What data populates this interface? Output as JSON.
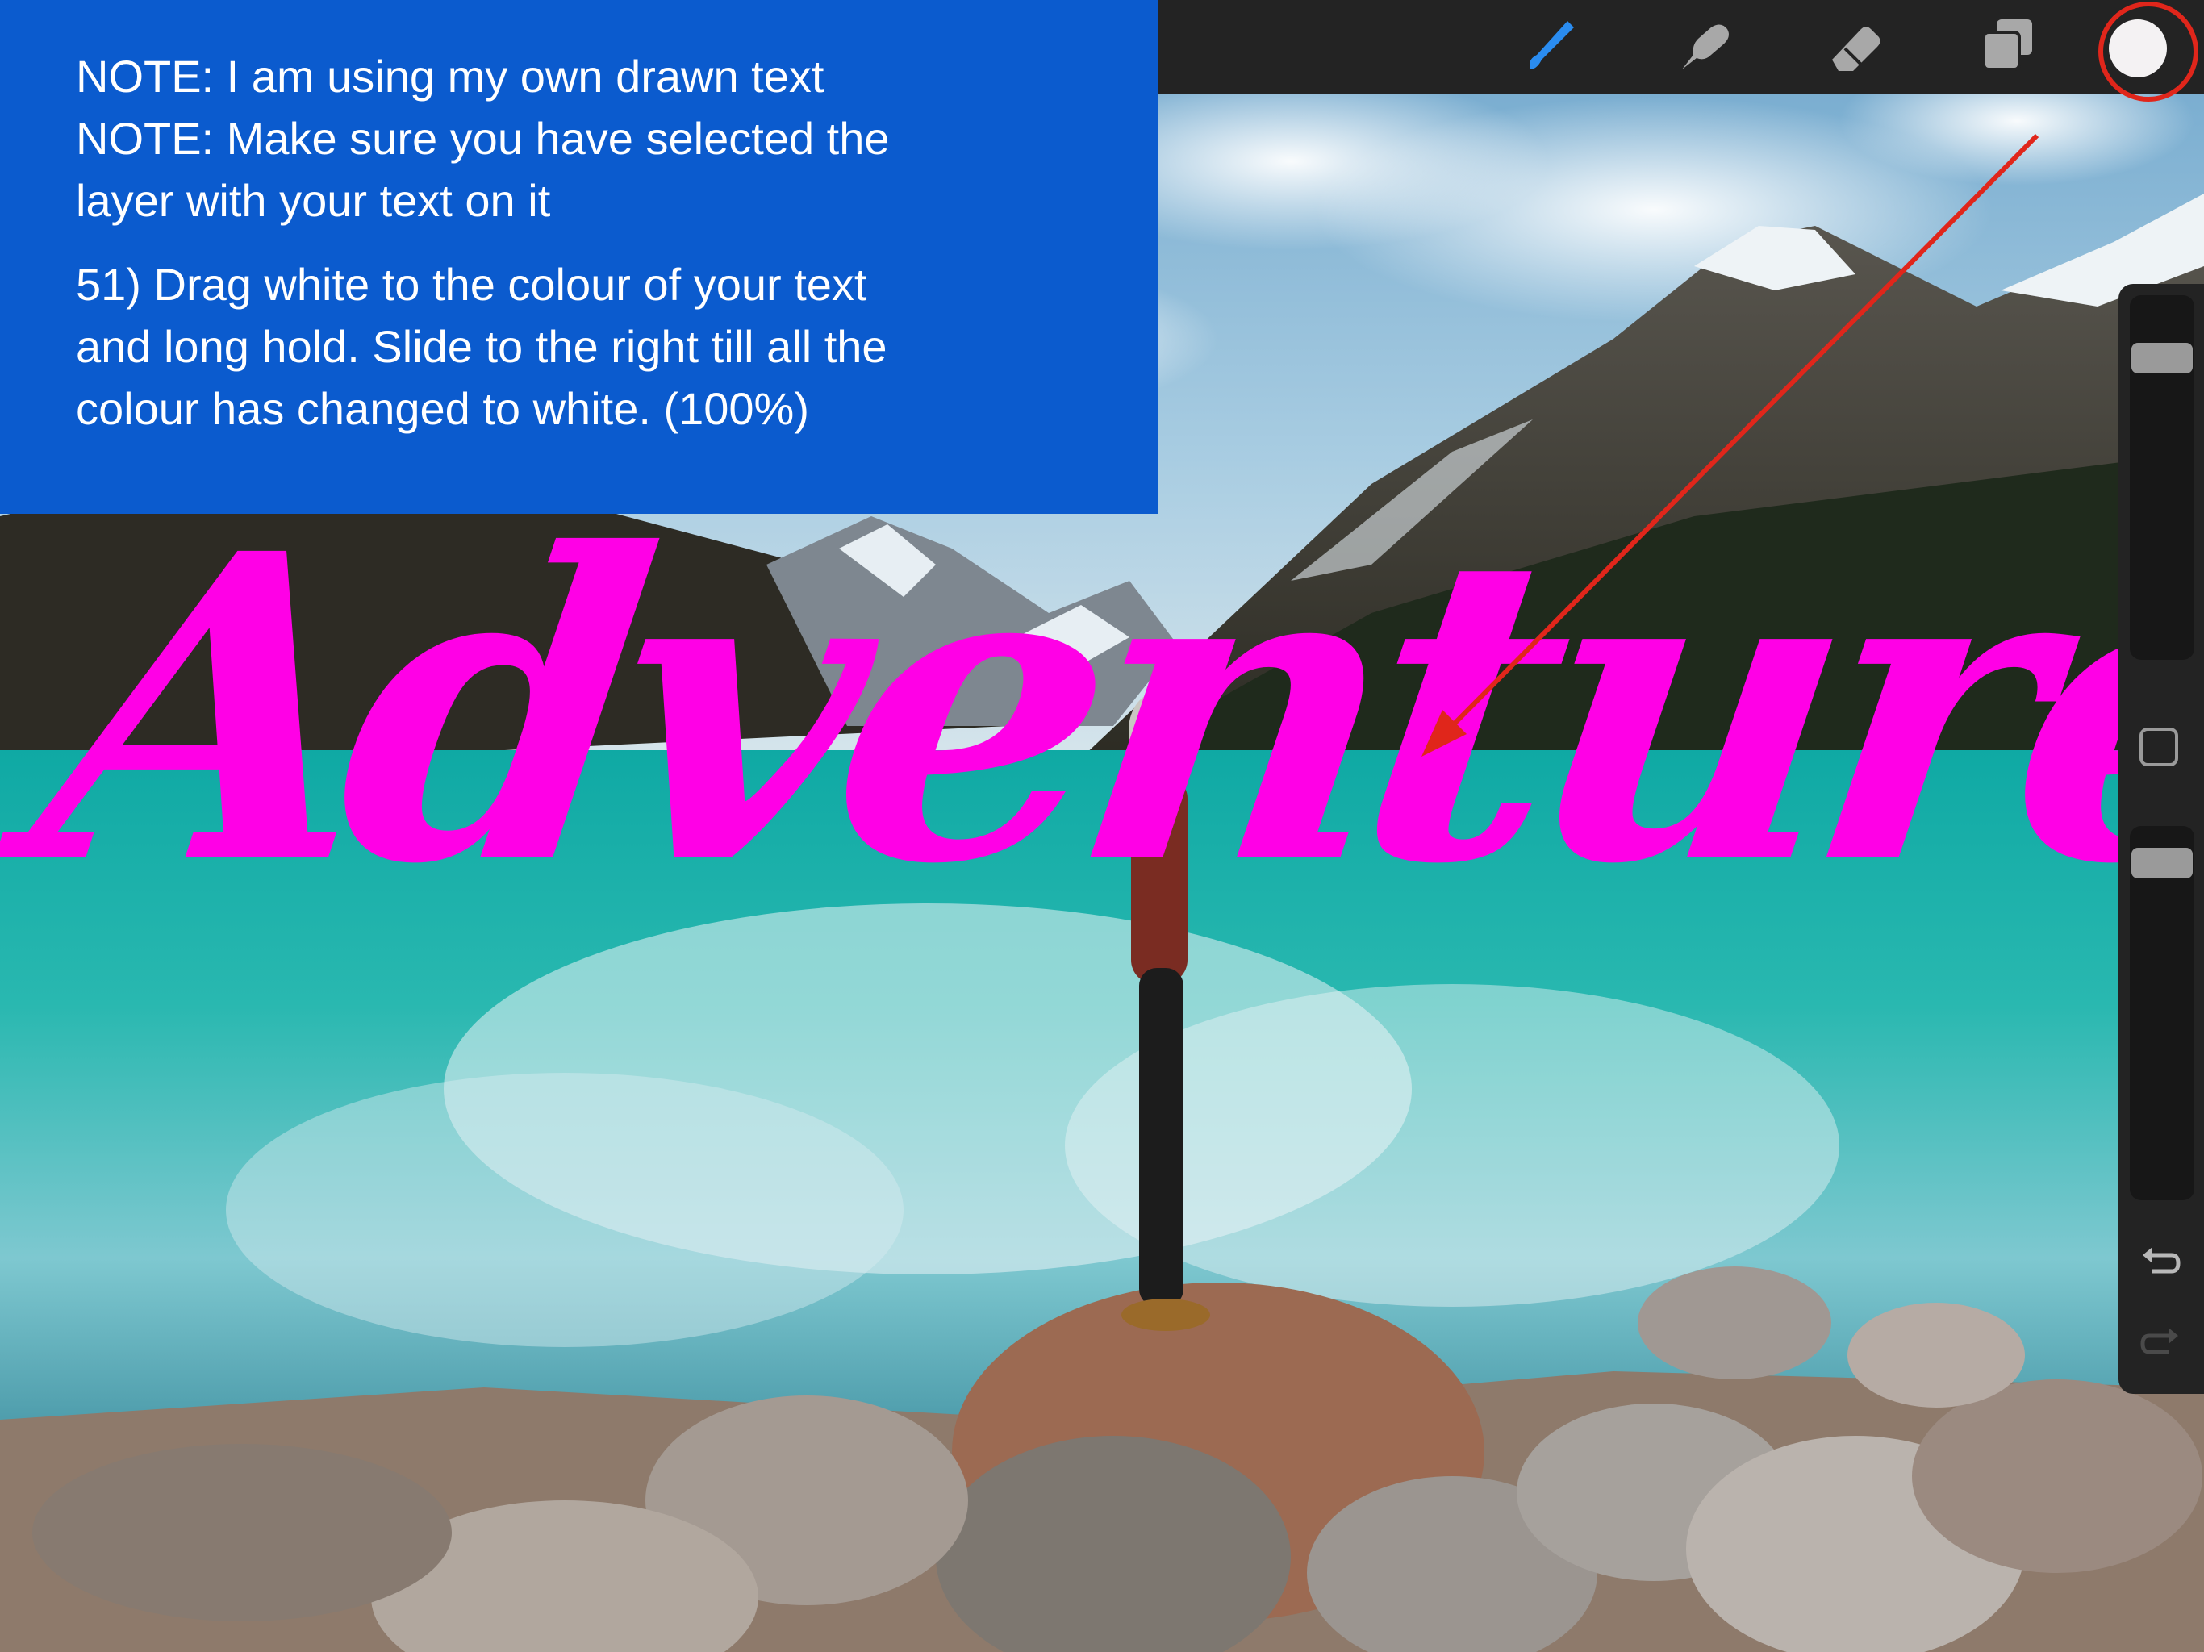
{
  "toolbar": {
    "tools": [
      "brush-icon",
      "smudge-icon",
      "eraser-icon",
      "layers-icon"
    ],
    "active_tool": "brush-icon",
    "accent_color": "#2a8cf0",
    "current_color": "#f4f2f3"
  },
  "annotation": {
    "note1": "NOTE: I am using my own drawn text",
    "note2": "NOTE: Make sure you have selected the",
    "note3": "layer with your text on it",
    "step1": "51) Drag white to the colour of your text",
    "step2": "and long hold. Slide to the right till all the",
    "step3": "colour has changed to white. (100%)",
    "background_color": "#0b5bce"
  },
  "canvas": {
    "artwork_text": "Adventure",
    "artwork_text_color": "#ff00e6"
  },
  "sidebar": {
    "brush_size": 0.86,
    "brush_opacity": 0.94,
    "undo_icon": "undo-icon",
    "redo_icon": "redo-icon"
  },
  "callout": {
    "color": "#e0261b"
  }
}
